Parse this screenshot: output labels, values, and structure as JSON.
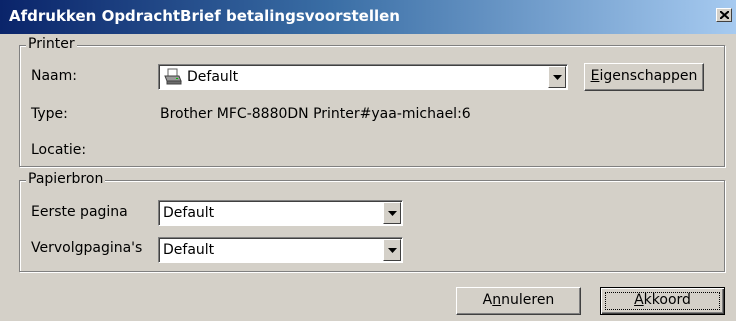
{
  "window": {
    "title": "Afdrukken OpdrachtBrief betalingsvoorstellen",
    "close_glyph": "✕"
  },
  "printer": {
    "legend": "Printer",
    "name_label": "Naam:",
    "name_value": "Default",
    "printer_icon": "printer-icon",
    "type_label": "Type:",
    "type_value": "Brother MFC-8880DN Printer#yaa-michael:6",
    "location_label": "Locatie:",
    "location_value": "",
    "properties_prefix": "",
    "properties_mnemonic": "E",
    "properties_rest": "igenschappen"
  },
  "paper": {
    "legend": "Papierbron",
    "first_label": "Eerste pagina",
    "first_value": "Default",
    "next_label": "Vervolgpagina's",
    "next_value": "Default"
  },
  "buttons": {
    "cancel_prefix": "A",
    "cancel_mnemonic": "n",
    "cancel_rest": "nuleren",
    "ok_prefix": "",
    "ok_mnemonic": "A",
    "ok_rest": "kkoord"
  }
}
